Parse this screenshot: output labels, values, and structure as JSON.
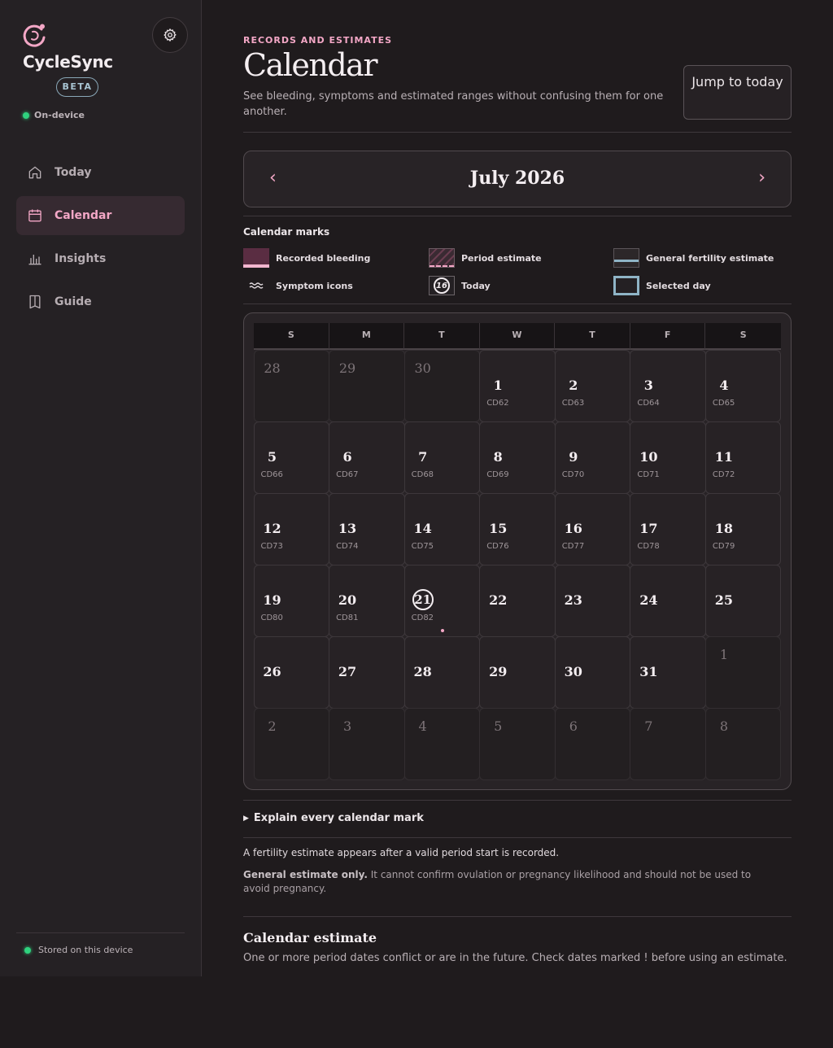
{
  "sidebar": {
    "brand": "CycleSync",
    "beta": "BETA",
    "status": "On-device",
    "items": [
      {
        "label": "Today",
        "icon": "home-icon",
        "active": false
      },
      {
        "label": "Calendar",
        "icon": "calendar-icon",
        "active": true
      },
      {
        "label": "Insights",
        "icon": "bar-chart-icon",
        "active": false
      },
      {
        "label": "Guide",
        "icon": "book-icon",
        "active": false
      }
    ],
    "footer": "Stored on this device"
  },
  "header": {
    "eyebrow": "RECORDS AND ESTIMATES",
    "title": "Calendar",
    "subtitle": "See bleeding, symptoms and estimated ranges without confusing them for one another.",
    "jump_button": "Jump to today"
  },
  "month": {
    "label": "July 2026",
    "prev": "‹",
    "next": "›"
  },
  "legend": {
    "title": "Calendar marks",
    "items": [
      {
        "label": "Recorded bleeding",
        "swatch": "bleed"
      },
      {
        "label": "Period estimate",
        "swatch": "period"
      },
      {
        "label": "General fertility estimate",
        "swatch": "fert"
      },
      {
        "label": "Symptom icons",
        "swatch": "symp"
      },
      {
        "label": "Today",
        "swatch": "today",
        "sample": "16"
      },
      {
        "label": "Selected day",
        "swatch": "sel"
      }
    ]
  },
  "calendar": {
    "weekdays": [
      "S",
      "M",
      "T",
      "W",
      "T",
      "F",
      "S"
    ],
    "days": [
      {
        "n": "28",
        "out": true
      },
      {
        "n": "29",
        "out": true
      },
      {
        "n": "30",
        "out": true
      },
      {
        "n": "1",
        "cd": "CD62"
      },
      {
        "n": "2",
        "cd": "CD63"
      },
      {
        "n": "3",
        "cd": "CD64"
      },
      {
        "n": "4",
        "cd": "CD65"
      },
      {
        "n": "5",
        "cd": "CD66"
      },
      {
        "n": "6",
        "cd": "CD67"
      },
      {
        "n": "7",
        "cd": "CD68"
      },
      {
        "n": "8",
        "cd": "CD69"
      },
      {
        "n": "9",
        "cd": "CD70"
      },
      {
        "n": "10",
        "cd": "CD71"
      },
      {
        "n": "11",
        "cd": "CD72"
      },
      {
        "n": "12",
        "cd": "CD73"
      },
      {
        "n": "13",
        "cd": "CD74"
      },
      {
        "n": "14",
        "cd": "CD75"
      },
      {
        "n": "15",
        "cd": "CD76"
      },
      {
        "n": "16",
        "cd": "CD77"
      },
      {
        "n": "17",
        "cd": "CD78"
      },
      {
        "n": "18",
        "cd": "CD79"
      },
      {
        "n": "19",
        "cd": "CD80"
      },
      {
        "n": "20",
        "cd": "CD81"
      },
      {
        "n": "21",
        "cd": "CD82",
        "today": true,
        "symptom": true
      },
      {
        "n": "22"
      },
      {
        "n": "23"
      },
      {
        "n": "24"
      },
      {
        "n": "25"
      },
      {
        "n": "26"
      },
      {
        "n": "27"
      },
      {
        "n": "28"
      },
      {
        "n": "29"
      },
      {
        "n": "30"
      },
      {
        "n": "31"
      },
      {
        "n": "1",
        "out": true
      },
      {
        "n": "2",
        "out": true
      },
      {
        "n": "3",
        "out": true
      },
      {
        "n": "4",
        "out": true
      },
      {
        "n": "5",
        "out": true
      },
      {
        "n": "6",
        "out": true
      },
      {
        "n": "7",
        "out": true
      },
      {
        "n": "8",
        "out": true
      }
    ]
  },
  "explain": "Explain every calendar mark",
  "notes": {
    "fertility": "A fertility estimate appears after a valid period start is recorded.",
    "general_bold": "General estimate only.",
    "general_rest": " It cannot confirm ovulation or pregnancy likelihood and should not be used to avoid pregnancy."
  },
  "estimate": {
    "title": "Calendar estimate",
    "text": "One or more period dates conflict or are in the future. Check dates marked ! before using an estimate."
  },
  "colors": {
    "accent": "#f3a7c6",
    "fertility": "#8fb4c6",
    "status_green": "#2fd27e",
    "background": "#1f1b1d"
  }
}
